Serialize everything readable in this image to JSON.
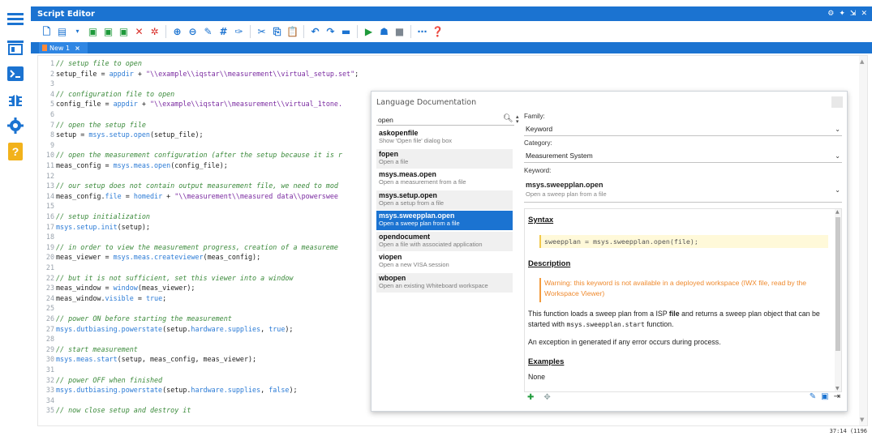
{
  "window": {
    "title": "Script Editor",
    "controls": [
      "gear-icon",
      "pin-icon",
      "maximize-icon",
      "close-icon"
    ]
  },
  "nav": [
    "menu-icon",
    "explorer-icon",
    "terminal-icon",
    "debug-icon",
    "settings-icon",
    "help-icon"
  ],
  "tab": {
    "label": "New 1",
    "close": "×"
  },
  "editor": {
    "lines": [
      {
        "n": "1",
        "parts": [
          [
            "cm",
            "// setup file to open"
          ]
        ]
      },
      {
        "n": "2",
        "parts": [
          [
            "tx",
            "setup_file = "
          ],
          [
            "kw",
            "appdir"
          ],
          [
            "tx",
            " + "
          ],
          [
            "st",
            "\"\\\\example\\\\iqstar\\\\measurement\\\\virtual_setup.set\""
          ],
          [
            "tx",
            ";"
          ]
        ]
      },
      {
        "n": "3",
        "parts": []
      },
      {
        "n": "4",
        "parts": [
          [
            "cm",
            "// configuration file to open"
          ]
        ]
      },
      {
        "n": "5",
        "parts": [
          [
            "tx",
            "config_file = "
          ],
          [
            "kw",
            "appdir"
          ],
          [
            "tx",
            " + "
          ],
          [
            "st",
            "\"\\\\example\\\\iqstar\\\\measurement\\\\virtual_1tone."
          ]
        ]
      },
      {
        "n": "6",
        "parts": []
      },
      {
        "n": "7",
        "parts": [
          [
            "cm",
            "// open the setup file"
          ]
        ]
      },
      {
        "n": "8",
        "parts": [
          [
            "tx",
            "setup = "
          ],
          [
            "kw",
            "msys.setup.open"
          ],
          [
            "tx",
            "(setup_file);"
          ]
        ]
      },
      {
        "n": "9",
        "parts": []
      },
      {
        "n": "10",
        "parts": [
          [
            "cm",
            "// open the measurement configuration (after the setup because it is r"
          ]
        ]
      },
      {
        "n": "11",
        "parts": [
          [
            "tx",
            "meas_config = "
          ],
          [
            "kw",
            "msys.meas.open"
          ],
          [
            "tx",
            "(config_file);"
          ]
        ]
      },
      {
        "n": "12",
        "parts": []
      },
      {
        "n": "13",
        "parts": [
          [
            "cm",
            "// our setup does not contain output measurement file, we need to mod"
          ]
        ]
      },
      {
        "n": "14",
        "parts": [
          [
            "tx",
            "meas_config."
          ],
          [
            "kwv",
            "file"
          ],
          [
            "tx",
            " = "
          ],
          [
            "kw",
            "homedir"
          ],
          [
            "tx",
            " + "
          ],
          [
            "st",
            "\"\\\\measurement\\\\measured data\\\\powerswee"
          ]
        ]
      },
      {
        "n": "15",
        "parts": []
      },
      {
        "n": "16",
        "parts": [
          [
            "cm",
            "// setup initialization"
          ]
        ]
      },
      {
        "n": "17",
        "parts": [
          [
            "kw",
            "msys.setup.init"
          ],
          [
            "tx",
            "(setup);"
          ]
        ]
      },
      {
        "n": "18",
        "parts": []
      },
      {
        "n": "19",
        "parts": [
          [
            "cm",
            "// in order to view the measurement progress, creation of a measureme"
          ]
        ]
      },
      {
        "n": "20",
        "parts": [
          [
            "tx",
            "meas_viewer = "
          ],
          [
            "kw",
            "msys.meas.createviewer"
          ],
          [
            "tx",
            "(meas_config);"
          ]
        ]
      },
      {
        "n": "21",
        "parts": []
      },
      {
        "n": "22",
        "parts": [
          [
            "cm",
            "// but it is not sufficient, set this viewer into a window"
          ]
        ]
      },
      {
        "n": "23",
        "parts": [
          [
            "tx",
            "meas_window = "
          ],
          [
            "kw",
            "window"
          ],
          [
            "tx",
            "(meas_viewer);"
          ]
        ]
      },
      {
        "n": "24",
        "parts": [
          [
            "tx",
            "meas_window."
          ],
          [
            "kwv",
            "visible"
          ],
          [
            "tx",
            " = "
          ],
          [
            "kw",
            "true"
          ],
          [
            "tx",
            ";"
          ]
        ]
      },
      {
        "n": "25",
        "parts": []
      },
      {
        "n": "26",
        "parts": [
          [
            "cm",
            "// power ON before starting the measurement"
          ]
        ]
      },
      {
        "n": "27",
        "parts": [
          [
            "kw",
            "msys.dutbiasing.powerstate"
          ],
          [
            "tx",
            "(setup."
          ],
          [
            "kwv",
            "hardware.supplies"
          ],
          [
            "tx",
            ", "
          ],
          [
            "kw",
            "true"
          ],
          [
            "tx",
            ");"
          ]
        ]
      },
      {
        "n": "28",
        "parts": []
      },
      {
        "n": "29",
        "parts": [
          [
            "cm",
            "// start measurement"
          ]
        ]
      },
      {
        "n": "30",
        "parts": [
          [
            "kw",
            "msys.meas.start"
          ],
          [
            "tx",
            "(setup, meas_config, meas_viewer);"
          ]
        ]
      },
      {
        "n": "31",
        "parts": []
      },
      {
        "n": "32",
        "parts": [
          [
            "cm",
            "// power OFF when finished"
          ]
        ]
      },
      {
        "n": "33",
        "parts": [
          [
            "kw",
            "msys.dutbiasing.powerstate"
          ],
          [
            "tx",
            "(setup."
          ],
          [
            "kwv",
            "hardware.supplies"
          ],
          [
            "tx",
            ", "
          ],
          [
            "kw",
            "false"
          ],
          [
            "tx",
            ");"
          ]
        ]
      },
      {
        "n": "34",
        "parts": []
      },
      {
        "n": "35",
        "parts": [
          [
            "cm",
            "// now close setup and destroy it"
          ]
        ]
      }
    ],
    "status": "37:14 (1196"
  },
  "langdoc": {
    "title": "Language Documentation",
    "search_value": "open",
    "items": [
      {
        "name": "askopenfile",
        "desc": "Show 'Open file' dialog box"
      },
      {
        "name": "fopen",
        "desc": "Open a file"
      },
      {
        "name": "msys.meas.open",
        "desc": "Open a measurement from a file"
      },
      {
        "name": "msys.setup.open",
        "desc": "Open a setup from a file"
      },
      {
        "name": "msys.sweepplan.open",
        "desc": "Open a sweep plan from a file"
      },
      {
        "name": "opendocument",
        "desc": "Open a file with associated application"
      },
      {
        "name": "viopen",
        "desc": "Open a new VISA session"
      },
      {
        "name": "wbopen",
        "desc": "Open an existing Whiteboard workspace"
      }
    ],
    "selected_index": 4,
    "family_label": "Family:",
    "family_value": "Keyword",
    "category_label": "Category:",
    "category_value": "Measurement System",
    "keyword_label": "Keyword:",
    "keyword_name": "msys.sweepplan.open",
    "keyword_desc": "Open a sweep plan from a file",
    "syntax_heading": "Syntax",
    "syntax_code": "sweepplan = msys.sweepplan.open(file);",
    "description_heading": "Description",
    "warning": "Warning: this keyword is not available in a deployed workspace (IWX file, read by the Workspace Viewer)",
    "desc_p1_a": "This function loads a sweep plan from a ISP ",
    "desc_p1_b": "file",
    "desc_p1_c": " and returns a sweep plan object that can be started with ",
    "desc_p1_code": "msys.sweepplan.start",
    "desc_p1_d": " function.",
    "desc_p2": "An exception in generated if any error occurs during process.",
    "examples_heading": "Examples",
    "examples_value": "None"
  },
  "colors": {
    "accent": "#1b73d1",
    "comment": "#3b8a3b",
    "string": "#7a2aa0",
    "keyword": "#2b7bd6",
    "warning": "#ef8a2e"
  }
}
